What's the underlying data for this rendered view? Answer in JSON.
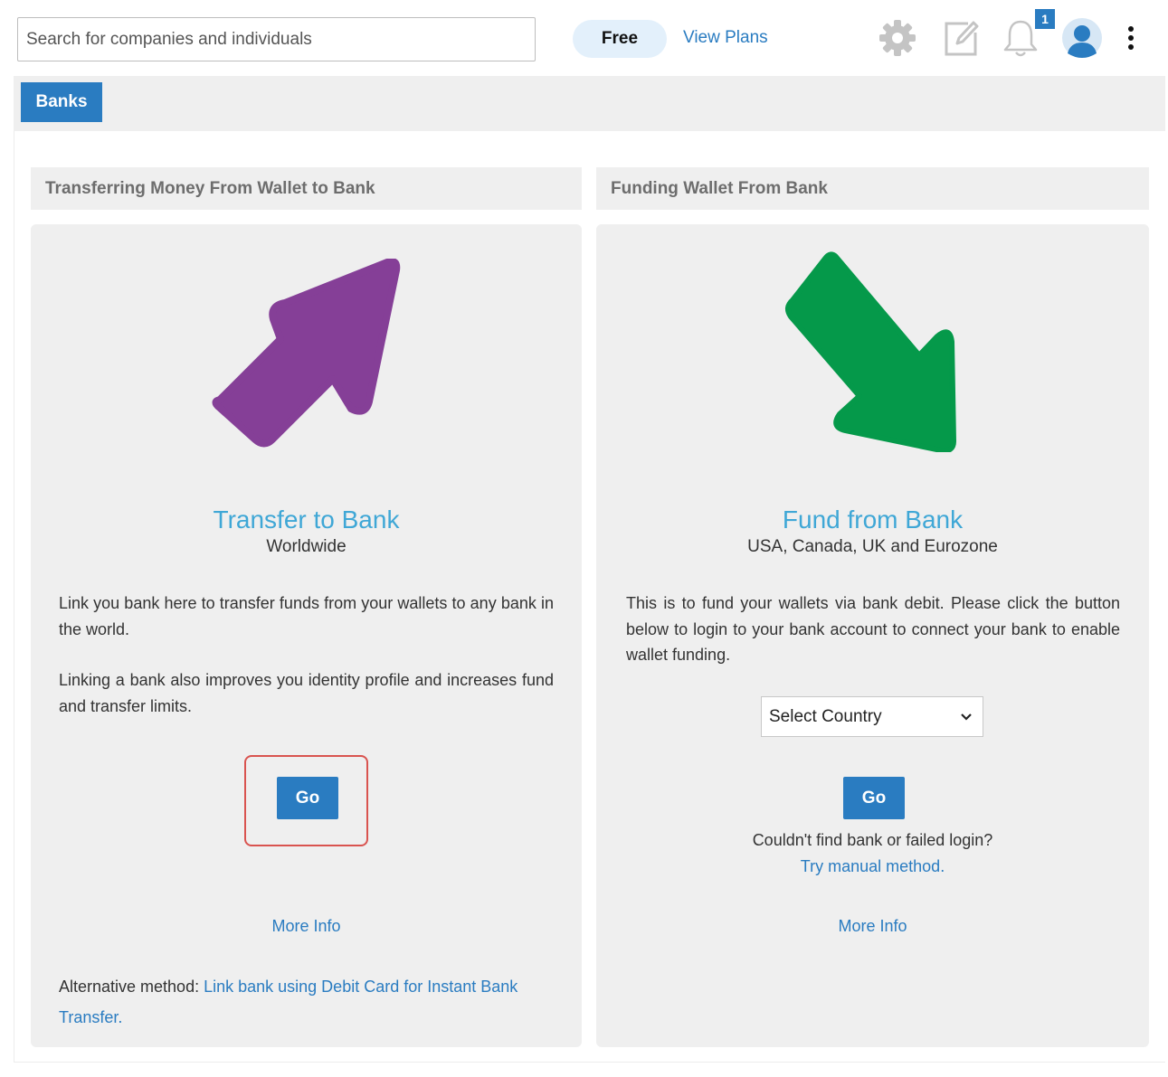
{
  "header": {
    "search_placeholder": "Search for companies and individuals",
    "plan_label": "Free",
    "view_plans_label": "View Plans",
    "notification_count": "1"
  },
  "tabs": [
    {
      "label": "Banks"
    }
  ],
  "left": {
    "section_title": "Transferring Money From Wallet to Bank",
    "title": "Transfer to Bank",
    "subtitle": "Worldwide",
    "para1": "Link you bank here to transfer funds from your wallets to any bank in the world.",
    "para2": "Linking a bank also improves you identity profile and increases fund and transfer limits.",
    "go_label": "Go",
    "more_info": "More Info",
    "alt_prefix": "Alternative method: ",
    "alt_link": "Link bank using Debit Card for Instant Bank Transfer."
  },
  "right": {
    "section_title": "Funding Wallet From Bank",
    "title": "Fund from Bank",
    "subtitle": "USA, Canada, UK and Eurozone",
    "para": "This is to fund your wallets via bank debit. Please click the button below to login to your bank account to connect your bank to enable wallet funding.",
    "select_value": "Select Country",
    "go_label": "Go",
    "fail_text": "Couldn't find bank or failed login?",
    "manual_link": "Try manual method.",
    "more_info": "More Info"
  },
  "colors": {
    "accent": "#2a7cc1",
    "title_blue": "#3fa7d6",
    "arrow_purple": "#853f97",
    "arrow_green": "#05994a",
    "highlight_red": "#d9534f"
  },
  "icons": [
    "gear-icon",
    "edit-icon",
    "bell-icon",
    "user-avatar-icon",
    "kebab-menu-icon",
    "up-right-arrow",
    "down-right-arrow",
    "chevron-down-icon"
  ]
}
